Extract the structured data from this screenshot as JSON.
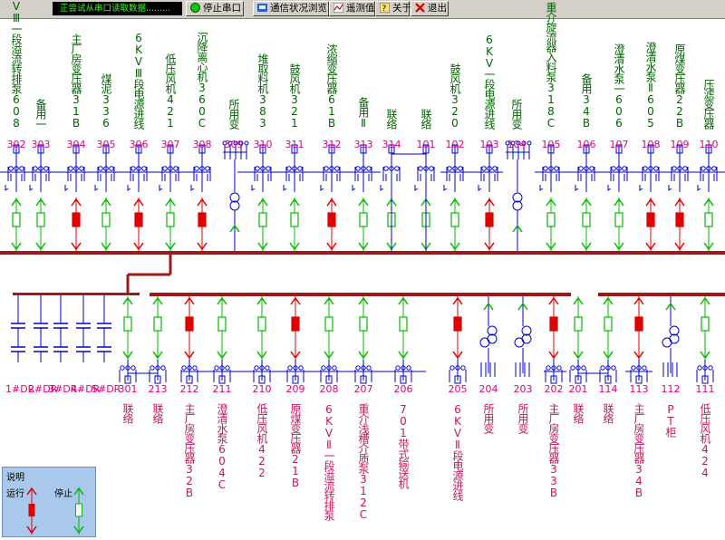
{
  "toolbar": {
    "status_text": "正尝试从串口读取数据.........",
    "buttons": [
      {
        "label": "停止串口",
        "icon": "green-circle-icon"
      },
      {
        "label": "通信状况浏览",
        "icon": "network-icon"
      },
      {
        "label": "遥测值",
        "icon": "meter-icon"
      },
      {
        "label": "关于",
        "icon": "help-icon"
      },
      {
        "label": "退出",
        "icon": "close-icon"
      }
    ]
  },
  "colors": {
    "bus": "#9b1b1b",
    "wire": "#0000cc",
    "running": "#e00000",
    "stopped": "#00bb00",
    "code": "#e0007a",
    "top_label": "#006400",
    "bottom_label": "#c2185b"
  },
  "top_feeders": [
    {
      "code": "302",
      "label": "6KVⅢ一段溢流转排泵608",
      "status": "stopped"
    },
    {
      "code": "303",
      "label": "备用一",
      "status": "stopped"
    },
    {
      "code": "304",
      "label": "主厂房变压器31B",
      "status": "running"
    },
    {
      "code": "305",
      "label": "煤泥336",
      "status": "stopped"
    },
    {
      "code": "306",
      "label": "6KVⅢ段电源进线",
      "status": "running"
    },
    {
      "code": "307",
      "label": "低压风机421",
      "status": "stopped"
    },
    {
      "code": "308",
      "label": "沉降离心机360C",
      "status": "running"
    },
    {
      "code": "309",
      "label": "所用变",
      "status": "pt"
    },
    {
      "code": "310",
      "label": "堆取料机383",
      "status": "stopped"
    },
    {
      "code": "311",
      "label": "鼓风机321",
      "status": "stopped"
    },
    {
      "code": "312",
      "label": "浓缩变压器61B",
      "status": "running"
    },
    {
      "code": "313",
      "label": "备用Ⅱ",
      "status": "stopped"
    },
    {
      "code": "314",
      "label": "联络",
      "status": "stopped"
    },
    {
      "code": "101",
      "label": "联络",
      "status": "stopped"
    },
    {
      "code": "102",
      "label": "鼓风机320",
      "status": "stopped"
    },
    {
      "code": "103",
      "label": "6KV一段电源进线",
      "status": "running"
    },
    {
      "code": "104",
      "label": "所用变",
      "status": "pt"
    },
    {
      "code": "105",
      "label": "重介旋流器入料泵318C",
      "status": "stopped"
    },
    {
      "code": "106",
      "label": "备用34B",
      "status": "stopped"
    },
    {
      "code": "107",
      "label": "澄清水泵一606",
      "status": "stopped"
    },
    {
      "code": "108",
      "label": "澄清水泵Ⅱ605",
      "status": "running"
    },
    {
      "code": "109",
      "label": "原煤变压器22B",
      "status": "running"
    },
    {
      "code": "110",
      "label": "压滤变压器",
      "status": "stopped"
    }
  ],
  "bottom_feeders": [
    {
      "code": "1#DR",
      "label": "",
      "status": "dr"
    },
    {
      "code": "2#DR",
      "label": "",
      "status": "dr"
    },
    {
      "code": "3#DR",
      "label": "",
      "status": "dr"
    },
    {
      "code": "4#DR",
      "label": "",
      "status": "dr"
    },
    {
      "code": "5#DR",
      "label": "",
      "status": "dr"
    },
    {
      "code": "301",
      "label": "联络",
      "status": "stopped"
    },
    {
      "code": "213",
      "label": "联络",
      "status": "stopped"
    },
    {
      "code": "212",
      "label": "主厂房变压器32B",
      "status": "running"
    },
    {
      "code": "211",
      "label": "澄清水泵604C",
      "status": "stopped"
    },
    {
      "code": "210",
      "label": "低压风机422",
      "status": "stopped"
    },
    {
      "code": "209",
      "label": "原煤变压器21B",
      "status": "running"
    },
    {
      "code": "208",
      "label": "6KVⅡ一段溢流转排泵",
      "status": "stopped"
    },
    {
      "code": "207",
      "label": "重介浅槽介质泵312C",
      "status": "stopped"
    },
    {
      "code": "206",
      "label": "701带式输送机",
      "status": "stopped"
    },
    {
      "code": "205",
      "label": "6KVⅡ段电源进线",
      "status": "running"
    },
    {
      "code": "204",
      "label": "所用变",
      "status": "pt"
    },
    {
      "code": "203",
      "label": "所用变",
      "status": "pt"
    },
    {
      "code": "202",
      "label": "主厂房变压器33B",
      "status": "running"
    },
    {
      "code": "201",
      "label": "联络",
      "status": "stopped"
    },
    {
      "code": "114",
      "label": "联络",
      "status": "stopped"
    },
    {
      "code": "113",
      "label": "主厂房变压器34B",
      "status": "running"
    },
    {
      "code": "112",
      "label": "PT柜",
      "status": "pt"
    },
    {
      "code": "111",
      "label": "低压风机424",
      "status": "stopped"
    }
  ],
  "legend": {
    "title": "说明",
    "running": "运行",
    "stopped": "停止"
  }
}
